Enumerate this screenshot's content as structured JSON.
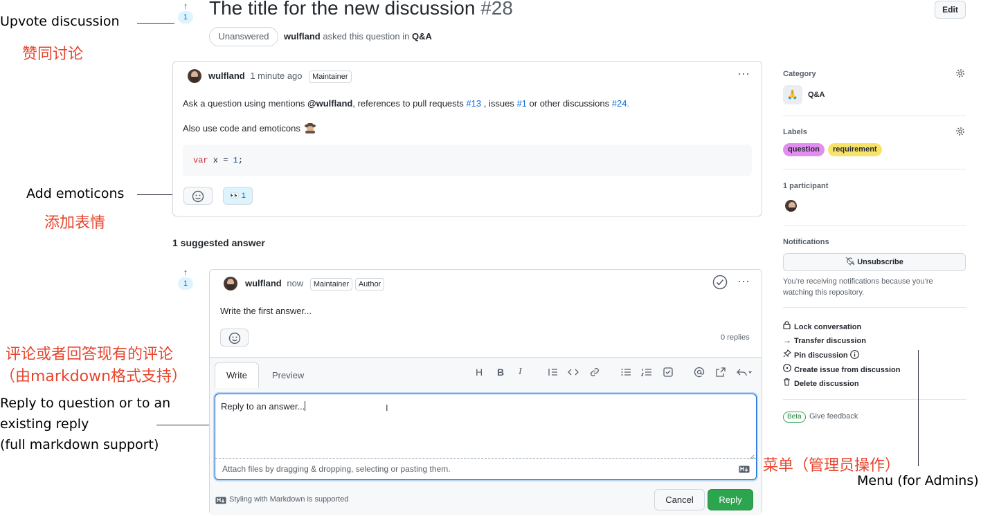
{
  "annotations": {
    "upvote_en": "Upvote discussion",
    "upvote_cn": "赞同讨论",
    "emoticons_en": "Add emoticons",
    "emoticons_cn": "添加表情",
    "comment_cn_1": "评论或者回答现有的评论",
    "comment_cn_2": "（由markdown格式支持）",
    "reply_en_1": "Reply to question or to an",
    "reply_en_2": "existing reply",
    "reply_en_3": "(full markdown support)",
    "menu_cn": "菜单（管理员操作）",
    "menu_en": "Menu (for Admins)"
  },
  "discussion": {
    "title": "The title for the new discussion",
    "number": "#28",
    "edit_label": "Edit",
    "status": "Unanswered",
    "author": "wulfland",
    "asked_text": "asked this question in",
    "category": "Q&A",
    "upvote_arrow": "↑",
    "upvotes": "1"
  },
  "post": {
    "author": "wulfland",
    "time": "1 minute ago",
    "badge": "Maintainer",
    "more": "···",
    "text_1": "Ask a question using mentions",
    "mention": "@wulfland",
    "text_2": ", references to pull requests",
    "pr_ref": "#13",
    "text_3": ", issues",
    "issue_ref": "#1",
    "text_4": "or other discussions",
    "disc_ref": "#24.",
    "text_5": "Also use code and emoticons",
    "code_keyword": "var",
    "code_rest": " x = ",
    "code_num": "1",
    "code_end": ";",
    "reaction_emoji": "👀",
    "reaction_count": "1"
  },
  "answers": {
    "heading": "1 suggested answer",
    "upvote_arrow": "↑",
    "upvotes": "1",
    "author": "wulfland",
    "time": "now",
    "badge_1": "Maintainer",
    "badge_2": "Author",
    "more": "···",
    "text": "Write the first answer...",
    "replies": "0 replies"
  },
  "editor": {
    "tab_write": "Write",
    "tab_preview": "Preview",
    "toolbar": [
      "H",
      "B",
      "I"
    ],
    "value": "Reply to an answer...",
    "attach_hint": "Attach files by dragging & dropping, selecting or pasting them.",
    "markdown_note": "Styling with Markdown is supported",
    "cancel": "Cancel",
    "reply": "Reply"
  },
  "sidebar": {
    "category_h": "Category",
    "category": "Q&A",
    "labels_h": "Labels",
    "labels": [
      {
        "name": "question",
        "color": "#e28ef0"
      },
      {
        "name": "requirement",
        "color": "#f8e36a"
      }
    ],
    "participants_h": "1 participant",
    "notifications_h": "Notifications",
    "unsubscribe": "Unsubscribe",
    "notif_text_1": "You’re receiving notifications because you’re",
    "notif_text_2": "watching this repository.",
    "menu": [
      {
        "label": "Lock conversation",
        "icon": "lock-icon"
      },
      {
        "label": "Transfer discussion",
        "icon": "arrow-right-icon"
      },
      {
        "label": "Pin discussion",
        "icon": "pin-icon"
      },
      {
        "label": "Create issue from discussion",
        "icon": "issue-icon"
      },
      {
        "label": "Delete discussion",
        "icon": "trash-icon"
      }
    ],
    "beta": "Beta",
    "feedback": "Give feedback"
  },
  "colors": {
    "accent": "#0969da",
    "primary_button": "#2da44e",
    "annotation_red": "#e8442c"
  }
}
